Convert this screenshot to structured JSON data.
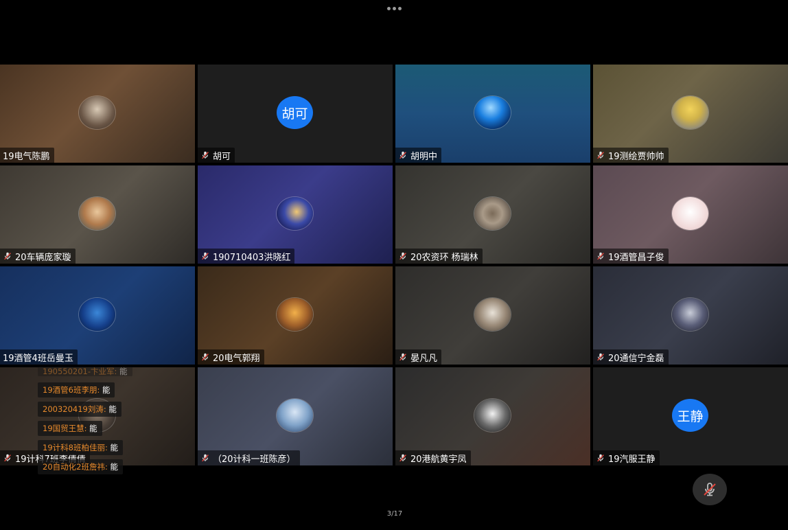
{
  "top_bar": {
    "more_icon": "more-horizontal-icon"
  },
  "participants": [
    {
      "name": "19电气陈鹏",
      "muted": false,
      "avatar_text": "",
      "bg": "linear-gradient(135deg,#4a3422,#6f5036 45%,#3a2c20)",
      "avatar_bg": "radial-gradient(circle at 50% 40%,#d8c9b5,#6a5646 60%,#3a2e25)"
    },
    {
      "name": "胡可",
      "muted": true,
      "avatar_text": "胡可",
      "bg": "#1e1e1e",
      "avatar_bg": ""
    },
    {
      "name": "胡明中",
      "muted": true,
      "avatar_text": "",
      "bg": "linear-gradient(180deg,#1c5a75,#1f4f7d 50%,#1a3f6b)",
      "avatar_bg": "radial-gradient(circle at 45% 35%,#9fd8ff,#1a7fe0 40%,#06285e 80%)"
    },
    {
      "name": "19测绘贾帅帅",
      "muted": true,
      "avatar_text": "",
      "bg": "linear-gradient(135deg,#5b5235,#6e6448 40%,#3c3a33)",
      "avatar_bg": "radial-gradient(circle at 50% 40%,#f2d35a,#d0b24a 40%,#8f8a7a 75%)"
    },
    {
      "name": "20车辆庞家璇",
      "muted": true,
      "avatar_text": "",
      "bg": "linear-gradient(135deg,#3e3932,#5a544a 50%,#2e2b27)",
      "avatar_bg": "radial-gradient(circle at 50% 45%,#e9c79c,#b07a4c 50%,#6b6456 80%)"
    },
    {
      "name": "190710403洪晓红",
      "muted": true,
      "avatar_text": "",
      "bg": "linear-gradient(135deg,#2a2a6a,#3b3c8a 45%,#1e2050)",
      "avatar_bg": "radial-gradient(circle at 55% 45%,#f1c874,#3b4aa8 45%,#1b1f5a 80%)"
    },
    {
      "name": "20农资环 杨瑞林",
      "muted": true,
      "avatar_text": "",
      "bg": "linear-gradient(135deg,#34332f,#4a4842 50%,#2a2926)",
      "avatar_bg": "radial-gradient(circle at 50% 50%,#7a6a58,#a99a88 40%,#5f554b 80%)"
    },
    {
      "name": "19酒管昌子俊",
      "muted": true,
      "avatar_text": "",
      "bg": "linear-gradient(135deg,#5b4a52,#6e5a60 45%,#3e3438)",
      "avatar_bg": "radial-gradient(circle at 50% 45%,#ffffff,#f3dede 55%,#e6c8c8 90%)"
    },
    {
      "name": "19酒管4班岳曼玉",
      "muted": false,
      "avatar_text": "",
      "bg": "linear-gradient(135deg,#16305e,#1d3f76 50%,#102448)",
      "avatar_bg": "radial-gradient(circle at 50% 45%,#3b87d8,#153f8a 55%,#0a1f45 90%)"
    },
    {
      "name": "20电气郭翔",
      "muted": true,
      "avatar_text": "",
      "bg": "linear-gradient(135deg,#3a2a1a,#5b4026 50%,#2a1e14)",
      "avatar_bg": "radial-gradient(circle at 50% 45%,#f2b04a,#a0602a 50%,#4a3020 85%)"
    },
    {
      "name": "晏凡凡",
      "muted": true,
      "avatar_text": "",
      "bg": "linear-gradient(135deg,#2e2d2b,#403e3a 50%,#222120)",
      "avatar_bg": "radial-gradient(circle at 50% 45%,#e8e2d8,#9a8a78 50%,#5a5046 85%)"
    },
    {
      "name": "20通信宁金磊",
      "muted": true,
      "avatar_text": "",
      "bg": "linear-gradient(135deg,#2a2d38,#3a3e4c 50%,#1f2129)",
      "avatar_bg": "radial-gradient(circle at 50% 45%,#c8ccd8,#5a5e78 50%,#2e3040 85%)"
    },
    {
      "name": "19计科7班李倩倩",
      "muted": true,
      "avatar_text": "",
      "bg": "linear-gradient(135deg,#2c2520,#3d342c 50%,#221d19)",
      "avatar_bg": "radial-gradient(circle at 50% 45%,#8a7a6a,#4a4038 55%,#2a2420 90%)"
    },
    {
      "name": "（20计科一班陈彦）",
      "muted": true,
      "avatar_text": "",
      "bg": "linear-gradient(135deg,#3a3f4e,#4a5064 50%,#2b2f3a)",
      "avatar_bg": "radial-gradient(circle at 50% 40%,#d9e6f5,#7fa2c8 50%,#3f5a80 85%)"
    },
    {
      "name": "20港航黄宇凤",
      "muted": true,
      "avatar_text": "",
      "bg": "linear-gradient(135deg,#2c2c2c,#3e3a36 50%,#4a2f26)",
      "avatar_bg": "radial-gradient(circle at 50% 45%,#f2f2f2,#6a6a6a 50%,#2a2a2a 85%)"
    },
    {
      "name": "19汽服王静",
      "muted": true,
      "avatar_text": "王静",
      "bg": "#1e1e1e",
      "avatar_bg": ""
    }
  ],
  "chat": [
    {
      "name": "190550201-卞业军",
      "sep": ":",
      "msg": "能",
      "faded": true
    },
    {
      "name": "19酒管6班李朋",
      "sep": ":",
      "msg": "能",
      "faded": false
    },
    {
      "name": "200320419刘涛",
      "sep": ":",
      "msg": "能",
      "faded": false
    },
    {
      "name": "19国贸王慧",
      "sep": ":",
      "msg": "能",
      "faded": false
    },
    {
      "name": "19计科8班柏佳丽",
      "sep": ":",
      "msg": "能",
      "faded": false
    },
    {
      "name": "20自动化2班詹祎",
      "sep": ":",
      "msg": "能",
      "faded": false
    }
  ],
  "controls": {
    "mute_icon": "microphone-muted-icon"
  },
  "pagination": {
    "text": "3/17"
  }
}
